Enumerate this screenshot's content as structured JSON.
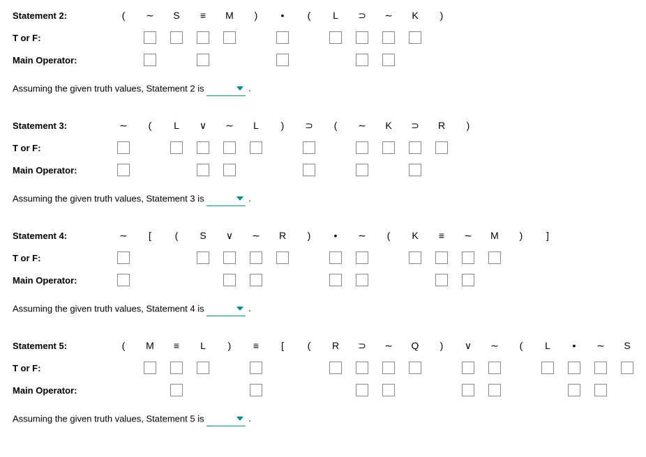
{
  "labels": {
    "torf": "T or F:",
    "mainop": "Main Operator:",
    "assume_prefix": "Assuming the given truth values, ",
    "assume_suffix": " is"
  },
  "statements": [
    {
      "id": 2,
      "title": "Statement 2:",
      "name": "Statement 2",
      "symbols": [
        "(",
        "∼",
        "S",
        "≡",
        "M",
        ")",
        "•",
        "(",
        "L",
        "⊃",
        "∼",
        "K",
        ")"
      ],
      "torf": [
        0,
        1,
        1,
        1,
        1,
        0,
        1,
        0,
        1,
        1,
        1,
        1,
        0
      ],
      "mainop": [
        0,
        1,
        0,
        1,
        0,
        0,
        1,
        0,
        0,
        1,
        1,
        0,
        0
      ]
    },
    {
      "id": 3,
      "title": "Statement 3:",
      "name": "Statement 3",
      "symbols": [
        "∼",
        "(",
        "L",
        "∨",
        "∼",
        "L",
        ")",
        "⊃",
        "(",
        "∼",
        "K",
        "⊃",
        "R",
        ")"
      ],
      "torf": [
        1,
        0,
        1,
        1,
        1,
        1,
        0,
        1,
        0,
        1,
        1,
        1,
        1,
        0
      ],
      "mainop": [
        1,
        0,
        0,
        1,
        1,
        0,
        0,
        1,
        0,
        1,
        0,
        1,
        0,
        0
      ]
    },
    {
      "id": 4,
      "title": "Statement 4:",
      "name": "Statement 4",
      "symbols": [
        "∼",
        "[",
        "(",
        "S",
        "∨",
        "∼",
        "R",
        ")",
        "•",
        "∼",
        "(",
        "K",
        "≡",
        "∼",
        "M",
        ")",
        "]"
      ],
      "torf": [
        1,
        0,
        0,
        1,
        1,
        1,
        1,
        0,
        1,
        1,
        0,
        1,
        1,
        1,
        1,
        0,
        0
      ],
      "mainop": [
        1,
        0,
        0,
        0,
        1,
        1,
        0,
        0,
        1,
        1,
        0,
        0,
        1,
        1,
        0,
        0,
        0
      ]
    },
    {
      "id": 5,
      "title": "Statement 5:",
      "name": "Statement 5",
      "symbols": [
        "(",
        "M",
        "≡",
        "L",
        ")",
        "≡",
        "[",
        "(",
        "R",
        "⊃",
        "∼",
        "Q",
        ")",
        "∨",
        "∼",
        "(",
        "L",
        "•",
        "∼",
        "S",
        ")",
        "]"
      ],
      "torf": [
        0,
        1,
        1,
        1,
        0,
        1,
        0,
        0,
        1,
        1,
        1,
        1,
        0,
        1,
        1,
        0,
        1,
        1,
        1,
        1,
        0,
        0
      ],
      "mainop": [
        0,
        0,
        1,
        0,
        0,
        1,
        0,
        0,
        0,
        1,
        1,
        0,
        0,
        1,
        1,
        0,
        0,
        1,
        1,
        0,
        0,
        0
      ]
    }
  ]
}
